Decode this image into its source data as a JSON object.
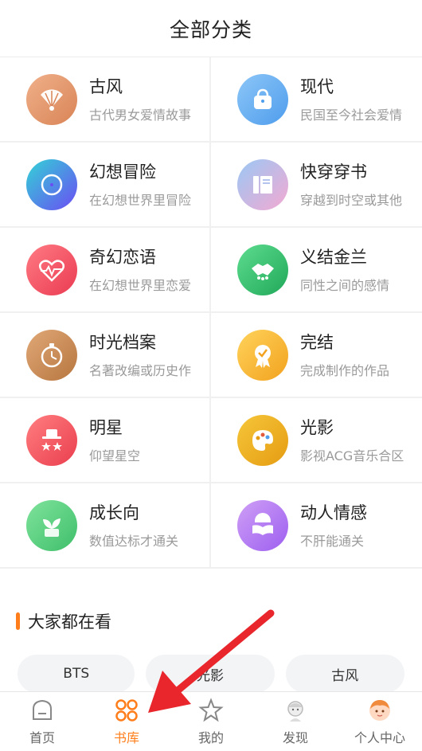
{
  "header": {
    "title": "全部分类"
  },
  "categories": [
    {
      "name": "古风",
      "desc": "古代男女爱情故事",
      "icon": "fan-icon",
      "color": "#e59a6c"
    },
    {
      "name": "现代",
      "desc": "民国至今社会爱情",
      "icon": "handbag-icon",
      "color": "#64aef0"
    },
    {
      "name": "幻想冒险",
      "desc": "在幻想世界里冒险",
      "icon": "compass-icon",
      "color": "#6a5cf2"
    },
    {
      "name": "快穿穿书",
      "desc": "穿越到时空或其他",
      "icon": "books-icon",
      "color": "#98b9ee"
    },
    {
      "name": "奇幻恋语",
      "desc": "在幻想世界里恋爱",
      "icon": "heart-pulse-icon",
      "color": "#f25a67"
    },
    {
      "name": "义结金兰",
      "desc": "同性之间的感情",
      "icon": "handshake-icon",
      "color": "#37c06e"
    },
    {
      "name": "时光档案",
      "desc": "名著改编或历史作",
      "icon": "stopwatch-icon",
      "color": "#cc8a55"
    },
    {
      "name": "完结",
      "desc": "完成制作的作品",
      "icon": "medal-icon",
      "color": "#f6b12f"
    },
    {
      "name": "明星",
      "desc": "仰望星空",
      "icon": "star-hat-icon",
      "color": "#f2555d"
    },
    {
      "name": "光影",
      "desc": "影视ACG音乐合区",
      "icon": "palette-icon",
      "color": "#f0b21c"
    },
    {
      "name": "成长向",
      "desc": "数值达标才通关",
      "icon": "sprout-icon",
      "color": "#5bd07d"
    },
    {
      "name": "动人情感",
      "desc": "不肝能通关",
      "icon": "open-book-icon",
      "color": "#b57af0"
    }
  ],
  "section": {
    "title": "大家都在看"
  },
  "tags": [
    "BTS",
    "光影",
    "古风"
  ],
  "tabbar": [
    {
      "label": "首页",
      "icon": "home-icon",
      "active": false
    },
    {
      "label": "书库",
      "icon": "grid-icon",
      "active": true
    },
    {
      "label": "我的",
      "icon": "star-icon",
      "active": false
    },
    {
      "label": "发现",
      "icon": "anime-avatar-icon",
      "active": false
    },
    {
      "label": "个人中心",
      "icon": "user-avatar-icon",
      "active": false
    }
  ],
  "colors": {
    "accent": "#ff7e1b",
    "arrow": "#e8262c"
  }
}
